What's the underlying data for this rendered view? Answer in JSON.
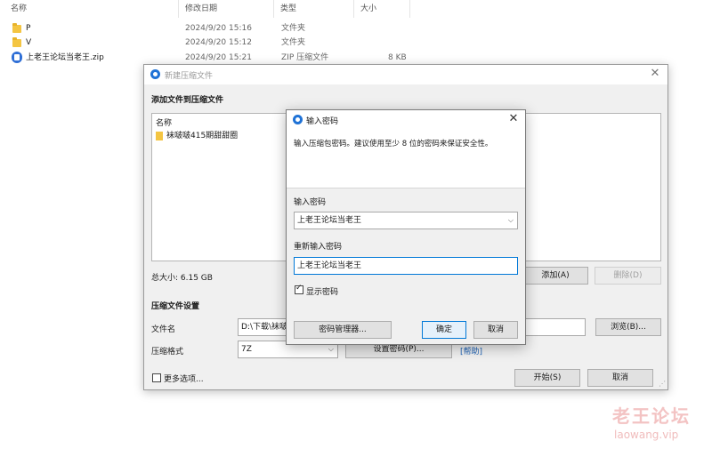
{
  "explorer": {
    "columns": {
      "name": "名称",
      "modified": "修改日期",
      "type": "类型",
      "size": "大小"
    },
    "files": [
      {
        "name": "P",
        "modified": "2024/9/20 15:16",
        "type": "文件夹",
        "size": "",
        "icon": "folder-icon"
      },
      {
        "name": "V",
        "modified": "2024/9/20 15:12",
        "type": "文件夹",
        "size": "",
        "icon": "folder-icon"
      },
      {
        "name": "上老王论坛当老王.zip",
        "modified": "2024/9/20 15:21",
        "type": "ZIP 压缩文件",
        "size": "8 KB",
        "icon": "zip-archive-icon"
      }
    ]
  },
  "compress_dialog": {
    "title": "新建压缩文件",
    "add_section": "添加文件到压缩文件",
    "list_header": "名称",
    "list_items": [
      "袜啵啵415期甜甜圈"
    ],
    "total_size": "总大小: 6.15 GB",
    "add_button": "添加(A)",
    "delete_button": "删除(D)",
    "settings_section": "压缩文件设置",
    "filename_label": "文件名",
    "filename_value": "D:\\下载\\袜啵",
    "browse_button": "浏览(B)...",
    "format_label": "压缩格式",
    "format_value": "7Z",
    "set_password_button": "设置密码(P)...",
    "help_link": "[帮助]",
    "more_options": "更多选项...",
    "start_button": "开始(S)",
    "cancel_button": "取消"
  },
  "password_dialog": {
    "title": "输入密码",
    "description": "输入压缩包密码。建议使用至少 8 位的密码来保证安全性。",
    "password_label": "输入密码",
    "password_value": "上老王论坛当老王",
    "confirm_label": "重新输入密码",
    "confirm_value": "上老王论坛当老王",
    "show_password_label": "显示密码",
    "show_password_checked": true,
    "manager_button": "密码管理器...",
    "ok_button": "确定",
    "cancel_button": "取消"
  },
  "watermark": {
    "title": "老王论坛",
    "url": "laowang.vip"
  },
  "colors": {
    "accent": "#0078d7",
    "folder": "#f4c542",
    "app_icon": "#1f72d6",
    "watermark": "#f3c3c3"
  }
}
